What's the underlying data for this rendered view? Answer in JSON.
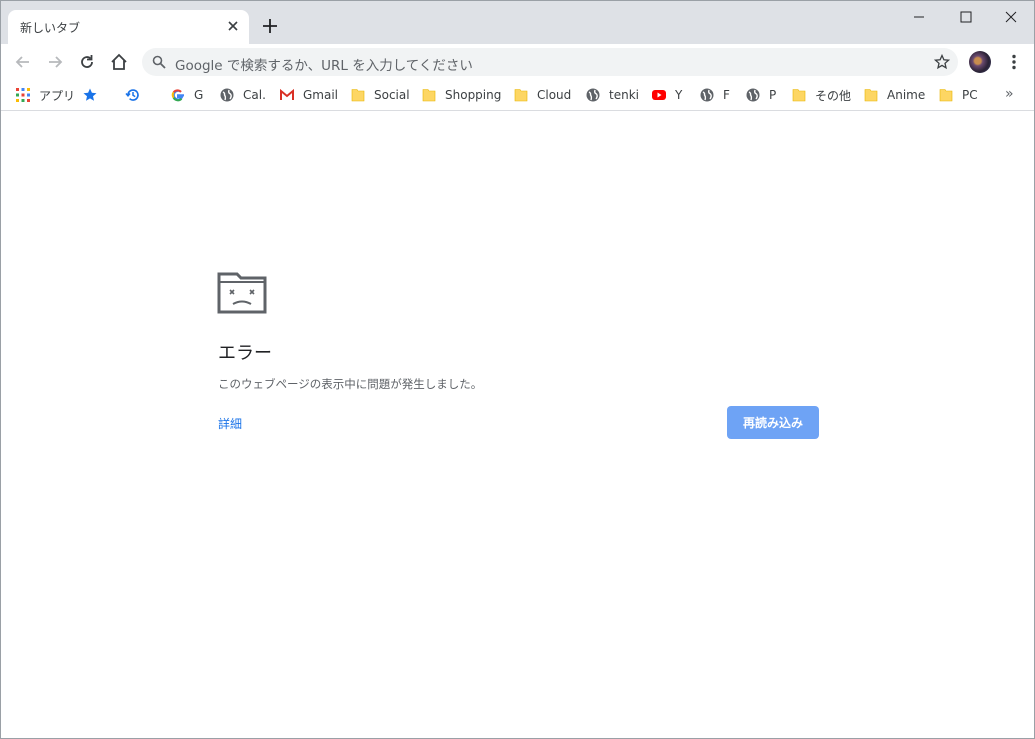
{
  "tab": {
    "title": "新しいタブ"
  },
  "omnibox": {
    "placeholder": "Google で検索するか、URL を入力してください"
  },
  "bookmarks": {
    "apps": "アプリ",
    "items": [
      {
        "label": "G",
        "icon": "google-icon"
      },
      {
        "label": "Cal.",
        "icon": "globe-icon"
      },
      {
        "label": "Gmail",
        "icon": "gmail-icon"
      },
      {
        "label": "Social",
        "icon": "folder-icon"
      },
      {
        "label": "Shopping",
        "icon": "folder-icon"
      },
      {
        "label": "Cloud",
        "icon": "folder-icon"
      },
      {
        "label": "tenki",
        "icon": "globe-icon"
      },
      {
        "label": "Y",
        "icon": "youtube-icon"
      },
      {
        "label": "F",
        "icon": "globe-icon"
      },
      {
        "label": "P",
        "icon": "globe-icon"
      },
      {
        "label": "その他",
        "icon": "folder-icon"
      },
      {
        "label": "Anime",
        "icon": "folder-icon"
      },
      {
        "label": "PC",
        "icon": "folder-icon"
      }
    ],
    "overflow": "»"
  },
  "error": {
    "title": "エラー",
    "description": "このウェブページの表示中に問題が発生しました。",
    "details_link": "詳細",
    "reload_button": "再読み込み"
  },
  "colors": {
    "accent": "#1a73e8",
    "reload_bg": "#6ea3f5",
    "tabstrip": "#dee1e6"
  }
}
